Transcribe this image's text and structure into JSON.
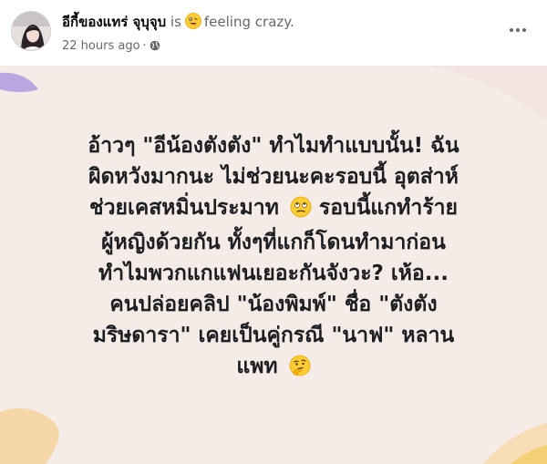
{
  "post": {
    "author_name": "อีกี้ของแทร่ จุบุจุบ",
    "feeling_prefix": "is",
    "feeling_text": "feeling crazy.",
    "timestamp": "22 hours ago",
    "separator": "·",
    "privacy_icon": "globe-icon",
    "feeling_emoji": "crazy-face-emoji",
    "more_icon": "ellipsis-icon"
  },
  "status": {
    "lines": [
      "อ้าวๆ \"อีน้องตังตัง\" ทำไมทำแบบนั้น! ฉัน",
      "ผิดหวังมากนะ ไม่ช่วยนะคะรอบนี้ อุตส่าห์",
      "ช่วยเคสหมิ่นประมาท",
      "รอบนี้แกทำร้าย",
      "ผู้หญิงด้วยกัน ทั้งๆที่แกก็โดนทำมาก่อน",
      "ทำไมพวกแกแฟนเยอะกันจังวะ? เห้อ...",
      "คนปล่อยคลิป \"น้องพิมพ์\" ชื่อ \"ตังตัง",
      "มริษดารา\" เคยเป็นคู่กรณี \"นาฟ\" หลาน",
      "แพท"
    ],
    "emoji_1": "eye-roll-emoji",
    "emoji_2": "thinking-face-emoji"
  },
  "colors": {
    "background": "#f5ebe7",
    "text": "#1c1e21",
    "meta": "#65676b",
    "accent_blob": "#b8a7e0",
    "accent_yellow": "#f2c84b"
  }
}
